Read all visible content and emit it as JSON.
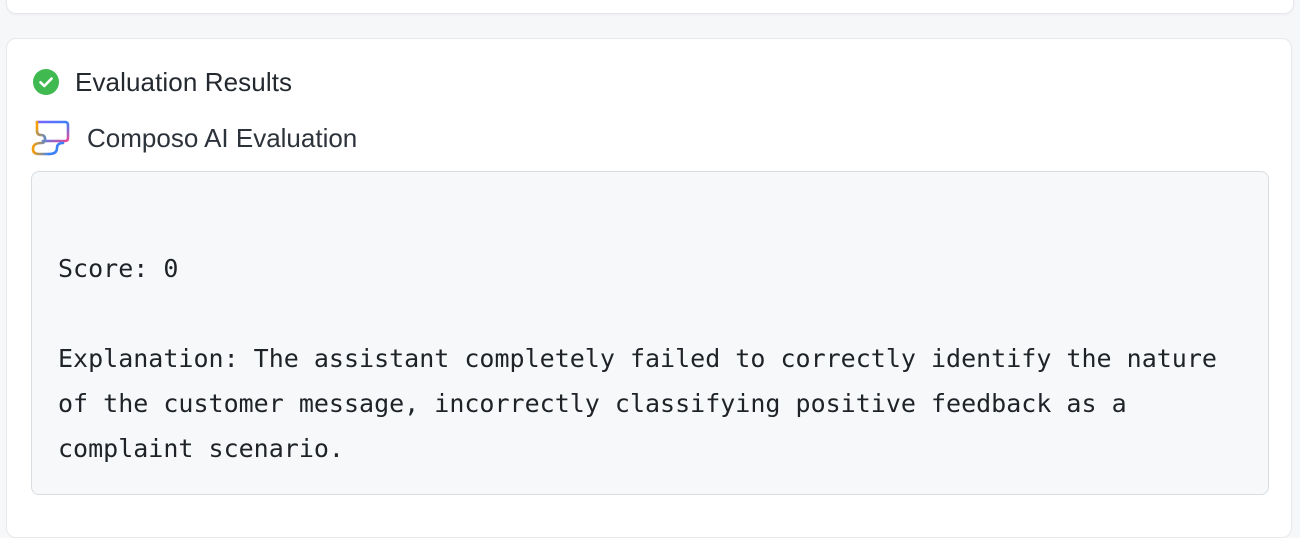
{
  "results": {
    "title": "Evaluation Results",
    "status_icon": "check-circle-icon",
    "status_color": "#3fb950"
  },
  "evaluation": {
    "provider_icon": "composo-logo-icon",
    "title": "Composo AI Evaluation",
    "score_line": "Score: 0",
    "explanation_line": "Explanation: The assistant completely failed to correctly identify the nature of the customer message, incorrectly classifying positive feedback as a complaint scenario."
  },
  "colors": {
    "background": "#f6f7f9",
    "card": "#ffffff",
    "code_bg": "#f6f8fa",
    "border": "#d8dde2"
  }
}
